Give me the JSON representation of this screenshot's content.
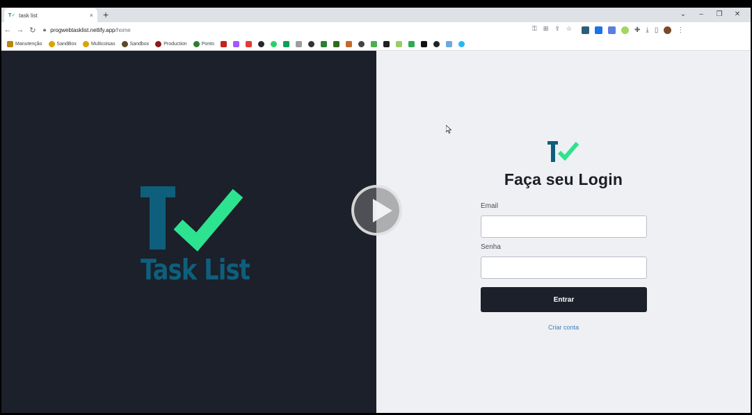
{
  "browser": {
    "tab_title": "task list",
    "tab_favicon": "T✓",
    "tab_close": "×",
    "new_tab": "+",
    "url_host": "progwebtasklist.netlify.app",
    "url_path": "/home",
    "window_controls": {
      "dropdown": "⌄",
      "minimize": "–",
      "restore": "❐",
      "close": "✕"
    }
  },
  "bookmarks": [
    {
      "label": "Manutenção",
      "color": "#b8860b"
    },
    {
      "label": "SandBox",
      "color": "#d9a400"
    },
    {
      "label": "Multicoisas",
      "color": "#d9a400"
    },
    {
      "label": "Sandbox",
      "color": "#5a4a2a"
    },
    {
      "label": "Production",
      "color": "#8b1a1a"
    },
    {
      "label": "Ponto",
      "color": "#2e7d32"
    }
  ],
  "app": {
    "big_logo_text": "Task List",
    "login_title": "Faça seu Login",
    "email_label": "Email",
    "email_value": "",
    "password_label": "Senha",
    "password_value": "",
    "submit_label": "Entrar",
    "create_account_label": "Criar conta"
  },
  "colors": {
    "dark_bg": "#1b202a",
    "brand_blue": "#0e5f7c",
    "brand_green": "#2de38f",
    "link": "#3f7fbf"
  }
}
